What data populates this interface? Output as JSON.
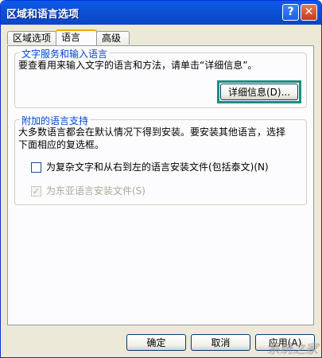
{
  "window": {
    "title": "区域和语言选项"
  },
  "titlebar_buttons": {
    "help": "?",
    "close": "✕"
  },
  "tabs": [
    {
      "label": "区域选项",
      "active": false
    },
    {
      "label": "语言",
      "active": true
    },
    {
      "label": "高级",
      "active": false
    }
  ],
  "text_services": {
    "legend": "文字服务和输入语言",
    "description": "要查看用来输入文字的语言和方法，请单击“详细信息”。",
    "details_button": "详细信息(D)..."
  },
  "supplemental": {
    "legend": "附加的语言支持",
    "description_line1": "大多数语言都会在默认情况下得到安装。要安装其他语言，选择",
    "description_line2": "下面相应的复选框。",
    "complex_script_label": "为复杂文字和从右到左的语言安装文件(包括泰文)(N)",
    "complex_script_checked": false,
    "east_asian_label": "为东亚语言安装文件(S)",
    "east_asian_checked": true,
    "east_asian_disabled": true
  },
  "footer": {
    "ok_label": "确定",
    "cancel_label": "取消",
    "apply_label": "应用(A)"
  },
  "watermark": "系统之家",
  "colors": {
    "titlebar": "#0a5ae8",
    "dialog_bg": "#ece9d8",
    "panel_bg": "#fcfcfe",
    "group_title": "#0046d5",
    "focus_highlight": "#1a8f7a",
    "active_tab_accent": "#f5a800"
  }
}
